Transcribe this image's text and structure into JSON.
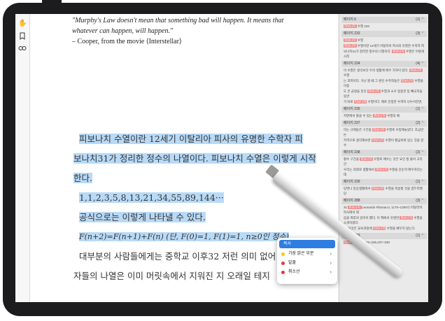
{
  "quote": {
    "line1": "\"Murphy's Law doesn't mean that something bad will happen. It means that",
    "line2": "whatever can happen, will happen.\"",
    "line3": "– Cooper, from the movie ⟨Interstellar⟩"
  },
  "body": {
    "p1_line1": "피보나치 수열이란 12세기 이탈리아 피사의 유명한 수학자 피",
    "p1_line2": "보나치31가 정리한 정수의 나열이다. 피보나치 수열은 이렇게 시작",
    "p1_line3": "한다.",
    "sequence": "1,1,2,3,5,8,13,21,34,55,89,144···",
    "formula_intro": "공식으로는 이렇게 나타낼 수 있다.",
    "formula": "F(n+2)=F(n+1)+F(n) (단, F(0)=1, F(1)=1, n≥0인 정수)",
    "p2_line1": "대부분의 사람들에게는 중학교 이후32 저런 의미 없어",
    "p2_line2": "자들의 나열은 이미 머릿속에서 지워진 지 오래일 테지"
  },
  "toolbar": {
    "icons": [
      "hand-icon",
      "bookmark-icon",
      "glasses-icon"
    ]
  },
  "sidebar": {
    "sections": [
      {
        "header": "페이지 6",
        "count": "(1)",
        "items": [
          "피보나치 수열 233"
        ]
      },
      {
        "header": "페이지 233",
        "count": "(3)",
        "items": [
          "피보나치 수열",
          "피보나치 수열이란 12세기 이탈리아 피사의 유명한 수학자 피",
          "보나치31가 정리한 정수의 나열이다. 피보나치 수열은 이렇게 시작"
        ]
      },
      {
        "header": "페이지 234",
        "count": "(4)",
        "items": [
          "이 수열은 생각보다 우리 생활에 매우 가까이 있다. 피보나치 수열",
          "는 과학이다. 거닌 할 때 그 원인 수학적들은 피보나치 수열을 이용",
          "도 큰 균형을 뜻다 피보나치 수열과 소수 업종한 등 빼곡히들 동반",
          "가 바로 피보나치 수열이다. 매로 인정한 수까지 나누어진면,"
        ]
      },
      {
        "header": "페이지 235",
        "count": "(1)",
        "items": [
          "자연에서 볼을 수 있는 피보나치 수열의 예"
        ]
      },
      {
        "header": "페이지 237",
        "count": "(2)",
        "items": [
          "이는 규제들은 구간을 피보나치 수열로 수정해놓았다. 조금만 논",
          "지역으로 생각해보면 피보나치 수열이 황금비와 있는 것을 알 수"
        ]
      },
      {
        "header": "페이지 238",
        "count": "(2)",
        "items": [
          "황수 구간을 피보나치 수열로 매우는 것은 요인 할 줄어 고리 안",
          "우리는 의외로 생활에서 피보나치 수열을 단순히 매우하다는데"
        ]
      },
      {
        "header": "페이지 239",
        "count": "(1)",
        "items": [
          "당연나 일상생활에서 피보나치 수열을 적용할 것을 염두라벤 당"
        ]
      },
      {
        "header": "페이지 288",
        "count": "(3)",
        "items": [
          "31 피보나치(Leonardo Fibonacci, 1170~1250?) 이탈리아 피사에서 태",
          "음을 여후의 일이이 했다. 이 책에서 유명한 피보나치 수열을 소개하였다.",
          "32 이것은 교육과정에 피보나치 수열을 배우지 않는다."
        ]
      },
      {
        "header": "페이지 293",
        "count": "(1)",
        "items": [
          "피보나치 수열 233~235,237~239"
        ]
      }
    ]
  },
  "context_menu": {
    "items": [
      {
        "label": "복사",
        "color": "",
        "has_submenu": false
      },
      {
        "label": "가장 밝은 부분",
        "color": "#f5c518",
        "has_submenu": true
      },
      {
        "label": "밑줄",
        "color": "#e23b3b",
        "has_submenu": true
      },
      {
        "label": "취소선",
        "color": "#e23b3b",
        "has_submenu": true
      }
    ]
  },
  "colors": {
    "selection": "#b8daf7",
    "highlight_tag": "#ef8a8a",
    "menu_selected": "#2f7de1"
  }
}
